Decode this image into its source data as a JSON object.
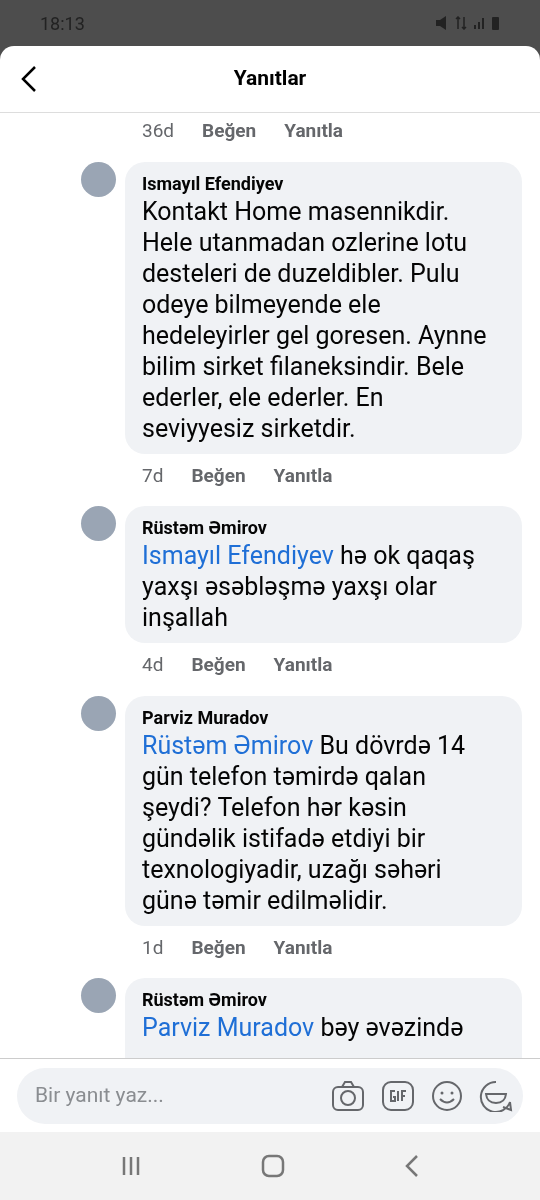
{
  "status_bar": {
    "time": "18:13"
  },
  "header": {
    "title": "Yanıtlar"
  },
  "previous_actions": {
    "time": "36d",
    "like": "Beğen",
    "reply": "Yanıtla"
  },
  "comments": [
    {
      "author": "Ismayıl Efendiyev",
      "text": "Kontakt Home masennikdir. Hele utanmadan ozlerine lotu desteleri de duzeldibler. Pulu odeye bilmeyende ele hedeleyirler gel goresen. Aynne bilim sirket filaneksindir. Bele ederler, ele ederler. En seviyyesiz sirketdir.",
      "time": "7d",
      "like": "Beğen",
      "reply": "Yanıtla"
    },
    {
      "author": "Rüstəm Əmirov",
      "mention": "Ismayıl Efendiyev",
      "text": "hə ok qaqaş yaxşı əsəbləşmə yaxşı olar inşallah",
      "time": "4d",
      "like": "Beğen",
      "reply": "Yanıtla"
    },
    {
      "author": "Parviz Muradov",
      "mention": "Rüstəm Əmirov",
      "text": "Bu dövrdə 14 gün telefon təmirdə qalan şeydi? Telefon hər kəsin gündəlik istifadə etdiyi bir texnologiyadir, uzağı səhəri günə təmir edilməlidir.",
      "time": "1d",
      "like": "Beğen",
      "reply": "Yanıtla"
    },
    {
      "author": "Rüstəm Əmirov",
      "mention": "Parviz Muradov",
      "text": "bəy əvəzində"
    }
  ],
  "composer": {
    "placeholder": "Bir yanıt yaz..."
  }
}
